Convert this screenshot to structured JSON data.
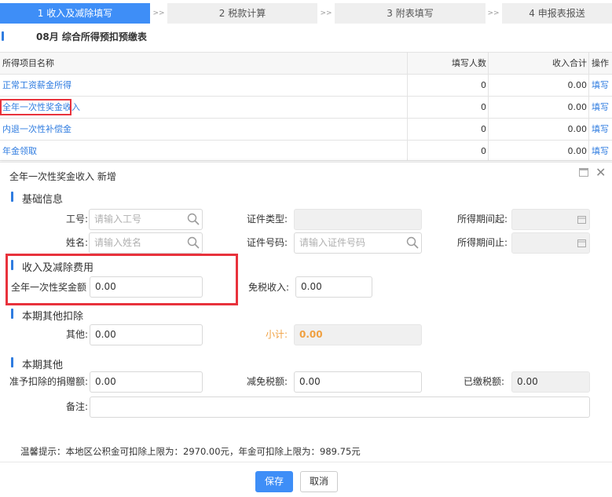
{
  "steps": [
    {
      "label": "1 收入及减除填写"
    },
    {
      "label": "2 税款计算"
    },
    {
      "label": "3 附表填写"
    },
    {
      "label": "4 申报表报送"
    }
  ],
  "step_separator": ">>",
  "page_title": "08月  综合所得预扣预缴表",
  "table": {
    "headers": {
      "name": "所得项目名称",
      "count": "填写人数",
      "total": "收入合计",
      "action": "操作"
    },
    "rows": [
      {
        "name": "正常工资薪金所得",
        "count": "0",
        "total": "0.00",
        "action": "填写"
      },
      {
        "name": "全年一次性奖金收入",
        "count": "0",
        "total": "0.00",
        "action": "填写"
      },
      {
        "name": "内退一次性补偿金",
        "count": "0",
        "total": "0.00",
        "action": "填写"
      },
      {
        "name": "年金领取",
        "count": "0",
        "total": "0.00",
        "action": "填写"
      }
    ]
  },
  "dialog": {
    "title": "全年一次性奖金收入 新增",
    "basic": {
      "section": "基础信息",
      "employee_id_label": "工号:",
      "employee_id_placeholder": "请输入工号",
      "id_type_label": "证件类型:",
      "period_start_label": "所得期间起:",
      "name_label": "姓名:",
      "name_placeholder": "请输入姓名",
      "id_number_label": "证件号码:",
      "id_number_placeholder": "请输入证件号码",
      "period_end_label": "所得期间止:"
    },
    "income": {
      "section": "收入及减除费用",
      "bonus_label": "全年一次性奖金额",
      "bonus_value": "0.00",
      "taxfree_label": "免税收入:",
      "taxfree_value": "0.00"
    },
    "other_deduct": {
      "section": "本期其他扣除",
      "other_label": "其他:",
      "other_value": "0.00",
      "subtotal_label": "小计:",
      "subtotal_value": "0.00"
    },
    "other": {
      "section": "本期其他",
      "donation_label": "准予扣除的捐赠额:",
      "donation_value": "0.00",
      "reduce_label": "减免税额:",
      "reduce_value": "0.00",
      "paid_label": "已缴税额:",
      "paid_value": "0.00",
      "remark_label": "备注:"
    },
    "tip": "温馨提示：本地区公积金可扣除上限为：2970.00元，年金可扣除上限为：989.75元",
    "save": "保存",
    "cancel": "取消"
  },
  "colors": {
    "accent": "#3e8ef7",
    "link": "#2f7ce0",
    "highlight": "#e8323c",
    "subtotal": "#f0a040"
  }
}
